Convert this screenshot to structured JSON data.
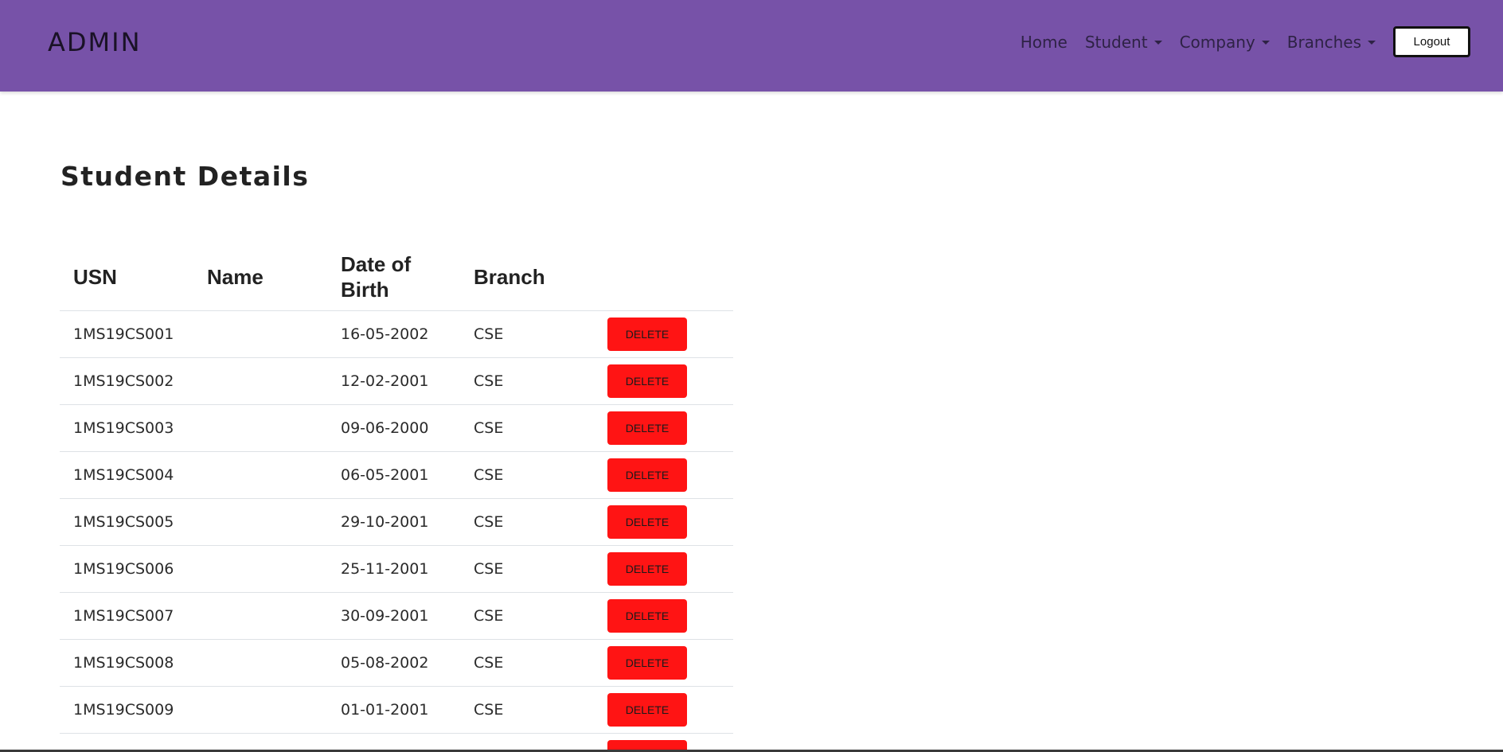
{
  "navbar": {
    "brand": "ADMIN",
    "links": [
      {
        "label": "Home",
        "dropdown": false
      },
      {
        "label": "Student",
        "dropdown": true
      },
      {
        "label": "Company",
        "dropdown": true
      },
      {
        "label": "Branches",
        "dropdown": true
      }
    ],
    "logout_label": "Logout"
  },
  "page": {
    "title": "Student Details"
  },
  "table": {
    "headers": {
      "usn": "USN",
      "name": "Name",
      "dob": "Date of Birth",
      "branch": "Branch"
    },
    "delete_label": "DELETE",
    "rows": [
      {
        "usn": "1MS19CS001",
        "name": "",
        "dob": "16-05-2002",
        "branch": "CSE"
      },
      {
        "usn": "1MS19CS002",
        "name": "",
        "dob": "12-02-2001",
        "branch": "CSE"
      },
      {
        "usn": "1MS19CS003",
        "name": "",
        "dob": "09-06-2000",
        "branch": "CSE"
      },
      {
        "usn": "1MS19CS004",
        "name": "",
        "dob": "06-05-2001",
        "branch": "CSE"
      },
      {
        "usn": "1MS19CS005",
        "name": "",
        "dob": "29-10-2001",
        "branch": "CSE"
      },
      {
        "usn": "1MS19CS006",
        "name": "",
        "dob": "25-11-2001",
        "branch": "CSE"
      },
      {
        "usn": "1MS19CS007",
        "name": "",
        "dob": "30-09-2001",
        "branch": "CSE"
      },
      {
        "usn": "1MS19CS008",
        "name": "",
        "dob": "05-08-2002",
        "branch": "CSE"
      },
      {
        "usn": "1MS19CS009",
        "name": "",
        "dob": "01-01-2001",
        "branch": "CSE"
      },
      {
        "usn": "",
        "name": "",
        "dob": "",
        "branch": ""
      }
    ]
  },
  "colors": {
    "navbar_bg": "#7752a8",
    "delete_bg": "#ff1414"
  }
}
